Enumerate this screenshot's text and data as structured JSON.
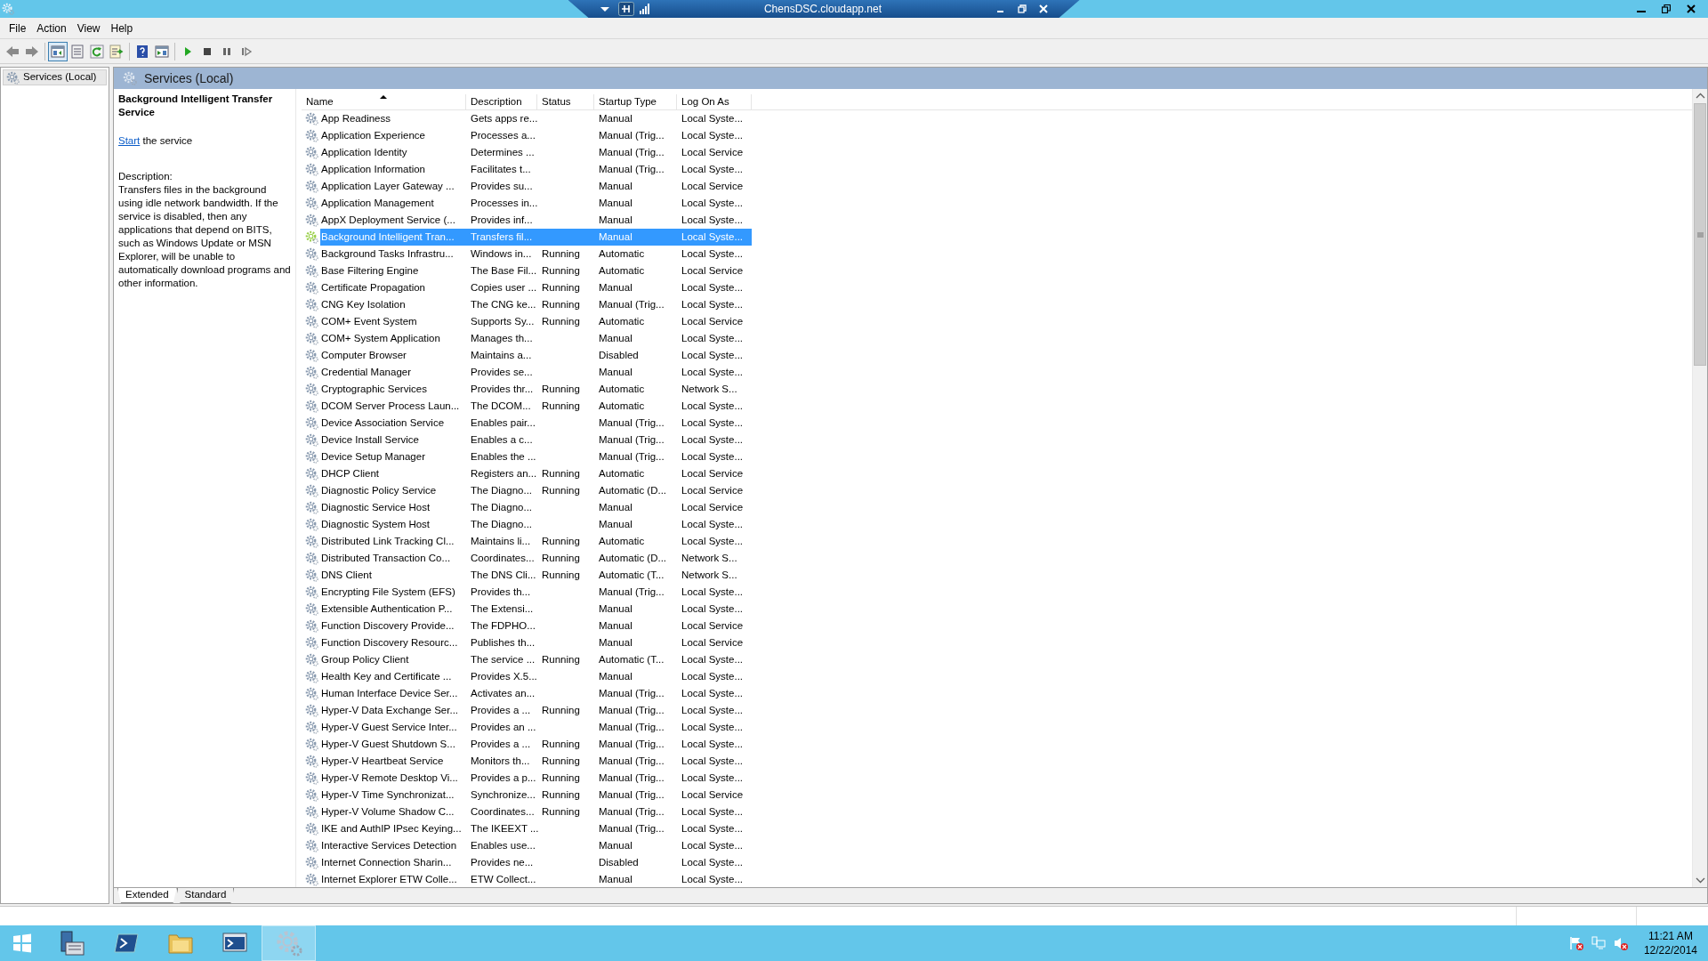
{
  "remote_bar": {
    "title": "ChensDSC.cloudapp.net"
  },
  "menu": [
    "File",
    "Action",
    "View",
    "Help"
  ],
  "toolbar": [
    {
      "kind": "back",
      "selected": false
    },
    {
      "kind": "forward",
      "selected": false
    },
    {
      "kind": "tree",
      "selected": true
    },
    {
      "kind": "properties",
      "selected": false
    },
    {
      "kind": "refresh",
      "selected": false
    },
    {
      "kind": "export",
      "selected": false
    },
    {
      "kind": "help",
      "selected": false
    },
    {
      "kind": "pane",
      "selected": false
    },
    {
      "kind": "start",
      "selected": false
    },
    {
      "kind": "stop",
      "selected": false
    },
    {
      "kind": "pause",
      "selected": false
    },
    {
      "kind": "resume",
      "selected": false
    }
  ],
  "tree": [
    {
      "label": "Services (Local)",
      "selected": true
    }
  ],
  "panel_header": "Services (Local)",
  "details": {
    "title": "Background Intelligent Transfer Service",
    "action_link": "Start",
    "action_text": "the service",
    "description_label": "Description:",
    "description": "Transfers files in the background using idle network bandwidth. If the service is disabled, then any applications that depend on BITS, such as Windows Update or MSN Explorer, will be unable to automatically download programs and other information."
  },
  "table": {
    "columns": [
      {
        "label": "Name",
        "sorted": true
      },
      {
        "label": "Description",
        "sorted": false
      },
      {
        "label": "Status",
        "sorted": false
      },
      {
        "label": "Startup Type",
        "sorted": false
      },
      {
        "label": "Log On As",
        "sorted": false
      }
    ],
    "rows": [
      {
        "name": "App Readiness",
        "description": "Gets apps re...",
        "startup_type": "Manual",
        "log_on_as": "Local Syste...",
        "selected": false
      },
      {
        "name": "Application Experience",
        "description": "Processes a...",
        "startup_type": "Manual (Trig...",
        "log_on_as": "Local Syste...",
        "selected": false
      },
      {
        "name": "Application Identity",
        "description": "Determines ...",
        "startup_type": "Manual (Trig...",
        "log_on_as": "Local Service",
        "selected": false
      },
      {
        "name": "Application Information",
        "description": "Facilitates t...",
        "startup_type": "Manual (Trig...",
        "log_on_as": "Local Syste...",
        "selected": false
      },
      {
        "name": "Application Layer Gateway ...",
        "description": "Provides su...",
        "startup_type": "Manual",
        "log_on_as": "Local Service",
        "selected": false
      },
      {
        "name": "Application Management",
        "description": "Processes in...",
        "startup_type": "Manual",
        "log_on_as": "Local Syste...",
        "selected": false
      },
      {
        "name": "AppX Deployment Service (...",
        "description": "Provides inf...",
        "startup_type": "Manual",
        "log_on_as": "Local Syste...",
        "selected": false
      },
      {
        "name": "Background Intelligent Tran...",
        "description": "Transfers fil...",
        "startup_type": "Manual",
        "log_on_as": "Local Syste...",
        "selected": true
      },
      {
        "name": "Background Tasks Infrastru...",
        "description": "Windows in...",
        "status": "Running",
        "startup_type": "Automatic",
        "log_on_as": "Local Syste...",
        "selected": false
      },
      {
        "name": "Base Filtering Engine",
        "description": "The Base Fil...",
        "status": "Running",
        "startup_type": "Automatic",
        "log_on_as": "Local Service",
        "selected": false
      },
      {
        "name": "Certificate Propagation",
        "description": "Copies user ...",
        "status": "Running",
        "startup_type": "Manual",
        "log_on_as": "Local Syste...",
        "selected": false
      },
      {
        "name": "CNG Key Isolation",
        "description": "The CNG ke...",
        "status": "Running",
        "startup_type": "Manual (Trig...",
        "log_on_as": "Local Syste...",
        "selected": false
      },
      {
        "name": "COM+ Event System",
        "description": "Supports Sy...",
        "status": "Running",
        "startup_type": "Automatic",
        "log_on_as": "Local Service",
        "selected": false
      },
      {
        "name": "COM+ System Application",
        "description": "Manages th...",
        "startup_type": "Manual",
        "log_on_as": "Local Syste...",
        "selected": false
      },
      {
        "name": "Computer Browser",
        "description": "Maintains a...",
        "startup_type": "Disabled",
        "log_on_as": "Local Syste...",
        "selected": false
      },
      {
        "name": "Credential Manager",
        "description": "Provides se...",
        "startup_type": "Manual",
        "log_on_as": "Local Syste...",
        "selected": false
      },
      {
        "name": "Cryptographic Services",
        "description": "Provides thr...",
        "status": "Running",
        "startup_type": "Automatic",
        "log_on_as": "Network S...",
        "selected": false
      },
      {
        "name": "DCOM Server Process Laun...",
        "description": "The DCOM...",
        "status": "Running",
        "startup_type": "Automatic",
        "log_on_as": "Local Syste...",
        "selected": false
      },
      {
        "name": "Device Association Service",
        "description": "Enables pair...",
        "startup_type": "Manual (Trig...",
        "log_on_as": "Local Syste...",
        "selected": false
      },
      {
        "name": "Device Install Service",
        "description": "Enables a c...",
        "startup_type": "Manual (Trig...",
        "log_on_as": "Local Syste...",
        "selected": false
      },
      {
        "name": "Device Setup Manager",
        "description": "Enables the ...",
        "startup_type": "Manual (Trig...",
        "log_on_as": "Local Syste...",
        "selected": false
      },
      {
        "name": "DHCP Client",
        "description": "Registers an...",
        "status": "Running",
        "startup_type": "Automatic",
        "log_on_as": "Local Service",
        "selected": false
      },
      {
        "name": "Diagnostic Policy Service",
        "description": "The Diagno...",
        "status": "Running",
        "startup_type": "Automatic (D...",
        "log_on_as": "Local Service",
        "selected": false
      },
      {
        "name": "Diagnostic Service Host",
        "description": "The Diagno...",
        "startup_type": "Manual",
        "log_on_as": "Local Service",
        "selected": false
      },
      {
        "name": "Diagnostic System Host",
        "description": "The Diagno...",
        "startup_type": "Manual",
        "log_on_as": "Local Syste...",
        "selected": false
      },
      {
        "name": "Distributed Link Tracking Cl...",
        "description": "Maintains li...",
        "status": "Running",
        "startup_type": "Automatic",
        "log_on_as": "Local Syste...",
        "selected": false
      },
      {
        "name": "Distributed Transaction Co...",
        "description": "Coordinates...",
        "status": "Running",
        "startup_type": "Automatic (D...",
        "log_on_as": "Network S...",
        "selected": false
      },
      {
        "name": "DNS Client",
        "description": "The DNS Cli...",
        "status": "Running",
        "startup_type": "Automatic (T...",
        "log_on_as": "Network S...",
        "selected": false
      },
      {
        "name": "Encrypting File System (EFS)",
        "description": "Provides th...",
        "startup_type": "Manual (Trig...",
        "log_on_as": "Local Syste...",
        "selected": false
      },
      {
        "name": "Extensible Authentication P...",
        "description": "The Extensi...",
        "startup_type": "Manual",
        "log_on_as": "Local Syste...",
        "selected": false
      },
      {
        "name": "Function Discovery Provide...",
        "description": "The FDPHO...",
        "startup_type": "Manual",
        "log_on_as": "Local Service",
        "selected": false
      },
      {
        "name": "Function Discovery Resourc...",
        "description": "Publishes th...",
        "startup_type": "Manual",
        "log_on_as": "Local Service",
        "selected": false
      },
      {
        "name": "Group Policy Client",
        "description": "The service ...",
        "status": "Running",
        "startup_type": "Automatic (T...",
        "log_on_as": "Local Syste...",
        "selected": false
      },
      {
        "name": "Health Key and Certificate ...",
        "description": "Provides X.5...",
        "startup_type": "Manual",
        "log_on_as": "Local Syste...",
        "selected": false
      },
      {
        "name": "Human Interface Device Ser...",
        "description": "Activates an...",
        "startup_type": "Manual (Trig...",
        "log_on_as": "Local Syste...",
        "selected": false
      },
      {
        "name": "Hyper-V Data Exchange Ser...",
        "description": "Provides a ...",
        "status": "Running",
        "startup_type": "Manual (Trig...",
        "log_on_as": "Local Syste...",
        "selected": false
      },
      {
        "name": "Hyper-V Guest Service Inter...",
        "description": "Provides an ...",
        "startup_type": "Manual (Trig...",
        "log_on_as": "Local Syste...",
        "selected": false
      },
      {
        "name": "Hyper-V Guest Shutdown S...",
        "description": "Provides a ...",
        "status": "Running",
        "startup_type": "Manual (Trig...",
        "log_on_as": "Local Syste...",
        "selected": false
      },
      {
        "name": "Hyper-V Heartbeat Service",
        "description": "Monitors th...",
        "status": "Running",
        "startup_type": "Manual (Trig...",
        "log_on_as": "Local Syste...",
        "selected": false
      },
      {
        "name": "Hyper-V Remote Desktop Vi...",
        "description": "Provides a p...",
        "status": "Running",
        "startup_type": "Manual (Trig...",
        "log_on_as": "Local Syste...",
        "selected": false
      },
      {
        "name": "Hyper-V Time Synchronizat...",
        "description": "Synchronize...",
        "status": "Running",
        "startup_type": "Manual (Trig...",
        "log_on_as": "Local Service",
        "selected": false
      },
      {
        "name": "Hyper-V Volume Shadow C...",
        "description": "Coordinates...",
        "status": "Running",
        "startup_type": "Manual (Trig...",
        "log_on_as": "Local Syste...",
        "selected": false
      },
      {
        "name": "IKE and AuthIP IPsec Keying...",
        "description": "The IKEEXT ...",
        "startup_type": "Manual (Trig...",
        "log_on_as": "Local Syste...",
        "selected": false
      },
      {
        "name": "Interactive Services Detection",
        "description": "Enables use...",
        "startup_type": "Manual",
        "log_on_as": "Local Syste...",
        "selected": false
      },
      {
        "name": "Internet Connection Sharin...",
        "description": "Provides ne...",
        "startup_type": "Disabled",
        "log_on_as": "Local Syste...",
        "selected": false
      },
      {
        "name": "Internet Explorer ETW Colle...",
        "description": "ETW Collect...",
        "startup_type": "Manual",
        "log_on_as": "Local Syste...",
        "selected": false
      }
    ]
  },
  "view_tabs": [
    {
      "label": "Extended",
      "selected": true
    },
    {
      "label": "Standard",
      "selected": false
    }
  ],
  "taskbar": {
    "apps": [
      {
        "kind": "start",
        "selected": false
      },
      {
        "kind": "server",
        "selected": false
      },
      {
        "kind": "shell",
        "selected": false
      },
      {
        "kind": "folder",
        "selected": false
      },
      {
        "kind": "console",
        "selected": false
      },
      {
        "kind": "services",
        "selected": true
      }
    ],
    "tray": [
      {
        "kind": "flag"
      },
      {
        "kind": "network"
      },
      {
        "kind": "speaker"
      }
    ],
    "time": "11:21 AM",
    "date": "12/22/2014"
  }
}
